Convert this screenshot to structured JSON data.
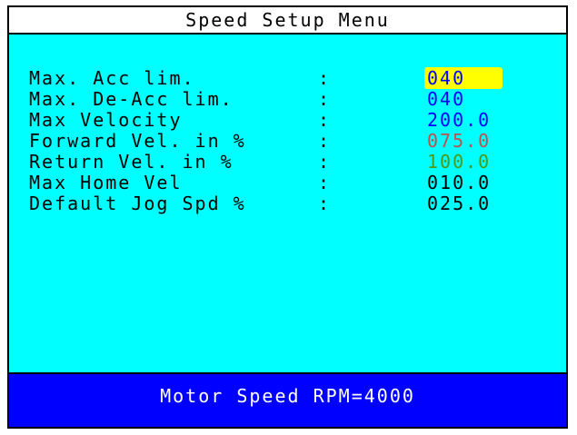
{
  "title": "Speed Setup Menu",
  "params": [
    {
      "label": "Max. Acc lim.",
      "colon": ":",
      "value": "040",
      "color": "#0000ff",
      "selected": true
    },
    {
      "label": "Max. De-Acc lim.",
      "colon": ":",
      "value": "040",
      "color": "#0000ff",
      "selected": false
    },
    {
      "label": "Max Velocity",
      "colon": ":",
      "value": "200.0",
      "color": "#0000ff",
      "selected": false
    },
    {
      "label": "Forward Vel. in %",
      "colon": ":",
      "value": "075.0",
      "color": "#c0504d",
      "selected": false
    },
    {
      "label": "Return Vel. in %",
      "colon": ":",
      "value": "100.0",
      "color": "#4a9a1a",
      "selected": false
    },
    {
      "label": "Max Home Vel",
      "colon": ":",
      "value": "010.0",
      "color": "#000000",
      "selected": false
    },
    {
      "label": "Default Jog Spd %",
      "colon": ":",
      "value": "025.0",
      "color": "#000000",
      "selected": false
    }
  ],
  "status": {
    "text": "Motor Speed RPM=4000"
  },
  "colors": {
    "panel_bg": "#00ffff",
    "status_bg": "#0000ff",
    "highlight_bg": "#ffff00"
  }
}
